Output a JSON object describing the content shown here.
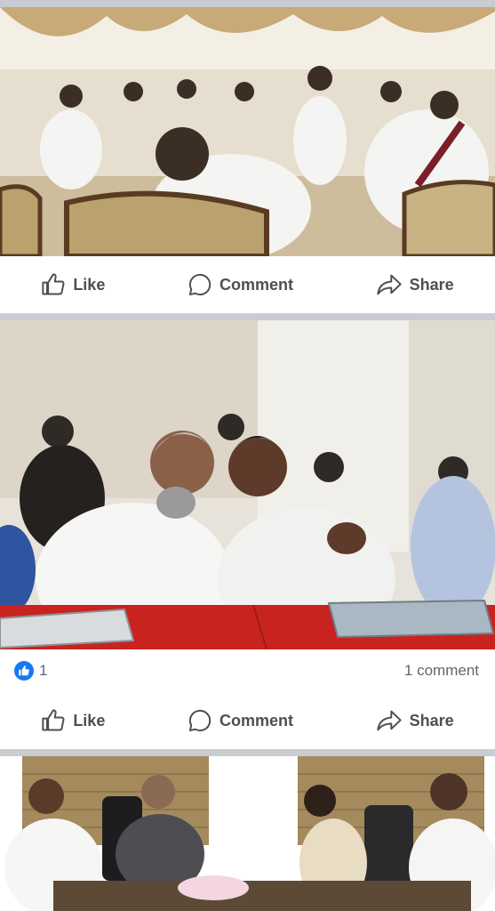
{
  "posts": [
    {
      "photo": {
        "alt": "group meeting in a formal hall",
        "colors": [
          "#a89a7a",
          "#e5dccb",
          "#d1c4ab",
          "#4d3a2a"
        ]
      },
      "actions": {
        "like": "Like",
        "comment": "Comment",
        "share": "Share"
      }
    },
    {
      "photo": {
        "alt": "two men conferring at a red table",
        "colors": [
          "#d8d2c6",
          "#f2f0eb",
          "#c02020",
          "#4d3a30"
        ]
      },
      "reactions": {
        "count": "1",
        "icon": "like-icon",
        "color": "#1877f2"
      },
      "comments_count": "1 comment",
      "actions": {
        "like": "Like",
        "comment": "Comment",
        "share": "Share"
      }
    },
    {
      "photo": {
        "alt": "meeting around a conference table",
        "colors": [
          "#eae6df",
          "#ffffff",
          "#7a6a50",
          "#3a3a3a"
        ]
      }
    }
  ]
}
